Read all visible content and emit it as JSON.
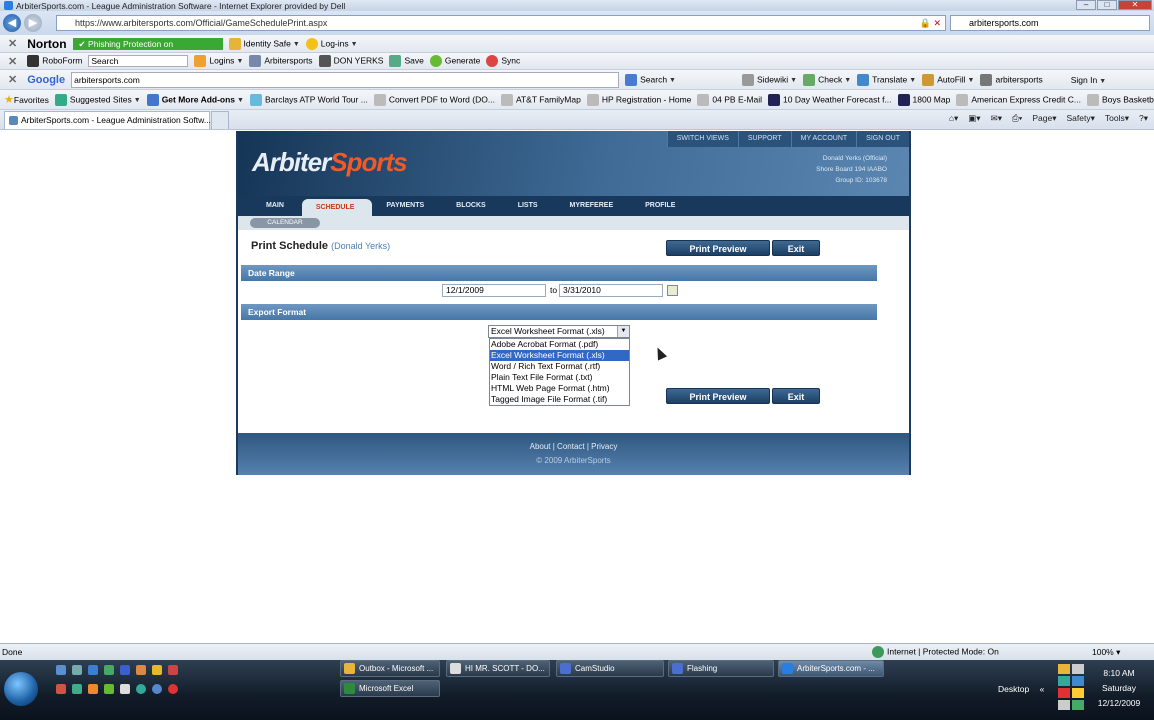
{
  "window": {
    "title": "ArbiterSports.com - League Administration Software - Internet Explorer provided by Dell"
  },
  "address": {
    "url": "https://www.arbitersports.com/Official/GameSchedulePrint.aspx",
    "search_tab": "arbitersports.com"
  },
  "norton": {
    "brand": "Norton",
    "phishing": "Phishing Protection on",
    "identity": "Identity Safe",
    "logins": "Log-ins"
  },
  "roboform": {
    "brand": "RoboForm",
    "search": "Search",
    "items": [
      "Logins",
      "Arbitersports",
      "DON YERKS",
      "Save",
      "Generate",
      "Sync"
    ]
  },
  "google": {
    "brand": "Google",
    "query": "arbitersports.com",
    "items": [
      "Search",
      "Sidewiki",
      "Check",
      "Translate",
      "AutoFill",
      "arbitersports",
      "Sign In"
    ]
  },
  "favorites": {
    "label": "Favorites",
    "items": [
      "Suggested Sites",
      "Get More Add-ons",
      "Barclays ATP World Tour ...",
      "Convert PDF to Word (DO...",
      "AT&T FamilyMap",
      "HP Registration - Home",
      "04 PB E-Mail",
      "10 Day Weather Forecast f...",
      "1800 Map",
      "American Express Credit C...",
      "Boys Basketball"
    ]
  },
  "tab": {
    "title": "ArbiterSports.com - League Administration Softw..."
  },
  "commandbar": {
    "page": "Page",
    "safety": "Safety",
    "tools": "Tools"
  },
  "site": {
    "logo_a": "Arbiter",
    "logo_b": "Sports",
    "toplinks": [
      "SWITCH VIEWS",
      "SUPPORT",
      "MY ACCOUNT",
      "SIGN OUT"
    ],
    "user": {
      "name": "Donald Yerks (Official)",
      "board": "Shore Board 194 IAABO",
      "group": "Group ID: 103678"
    },
    "nav": [
      "MAIN",
      "SCHEDULE",
      "PAYMENTS",
      "BLOCKS",
      "LISTS",
      "MYREFEREE",
      "PROFILE"
    ],
    "subnav": "CALENDAR",
    "page_title": "Print Schedule",
    "page_user": "(Donald Yerks)",
    "print_preview": "Print Preview",
    "exit": "Exit",
    "date_range": "Date Range",
    "date_from": "12/1/2009",
    "to": "to",
    "date_to": "3/31/2010",
    "export_format": "Export Format",
    "select_value": "Excel Worksheet Format (.xls)",
    "options": [
      "Adobe Acrobat Format (.pdf)",
      "Excel Worksheet Format (.xls)",
      "Word / Rich Text Format (.rtf)",
      "Plain Text File Format (.txt)",
      "HTML Web Page Format (.htm)",
      "Tagged Image File Format (.tif)"
    ],
    "footer_links": "About | Contact | Privacy",
    "copyright": "© 2009 ArbiterSports"
  },
  "status": {
    "left": "Done",
    "zone": "Internet | Protected Mode: On",
    "zoom": "100%"
  },
  "taskbar": {
    "tasks": [
      "Outbox - Microsoft ...",
      "HI MR. SCOTT - DO...",
      "CamStudio",
      "Flashing",
      "ArbiterSports.com - ...",
      "Microsoft Excel"
    ],
    "desktop": "Desktop",
    "time": "8:10 AM",
    "day": "Saturday",
    "date": "12/12/2009"
  }
}
